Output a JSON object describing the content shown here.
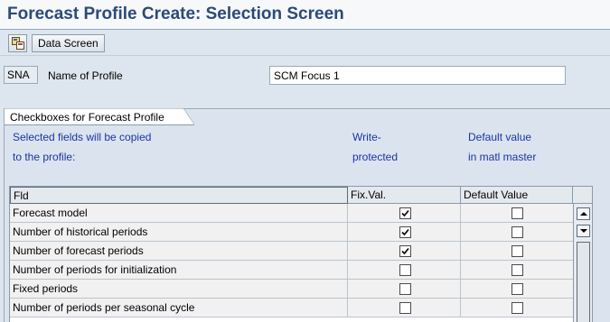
{
  "window": {
    "title": "Forecast Profile Create: Selection Screen"
  },
  "toolbar": {
    "icon_button": "screen-switch-icon",
    "data_screen_label": "Data Screen"
  },
  "profile": {
    "code": "SNA",
    "name_label": "Name of Profile",
    "name_value": "SCM Focus 1"
  },
  "group": {
    "title": "Checkboxes for Forecast Profile",
    "info_line1": "Selected fields will be copied",
    "info_line2": "to the profile:",
    "write_line1": "Write-",
    "write_line2": "protected",
    "default_line1": "Default value",
    "default_line2": "in matl master"
  },
  "table": {
    "columns": [
      "Fld",
      "Fix.Val.",
      "Default Value"
    ],
    "rows": [
      {
        "field": "Forecast model",
        "fix_val": true,
        "default_value": false
      },
      {
        "field": "Number of historical periods",
        "fix_val": true,
        "default_value": false
      },
      {
        "field": "Number of forecast periods",
        "fix_val": true,
        "default_value": false
      },
      {
        "field": "Number of periods for initialization",
        "fix_val": false,
        "default_value": false
      },
      {
        "field": "Fixed periods",
        "fix_val": false,
        "default_value": false
      },
      {
        "field": "Number of periods per seasonal cycle",
        "fix_val": false,
        "default_value": false
      }
    ]
  },
  "colors": {
    "title": "#2b4a78",
    "info_text": "#1a32a8",
    "background": "#dde6ee"
  }
}
